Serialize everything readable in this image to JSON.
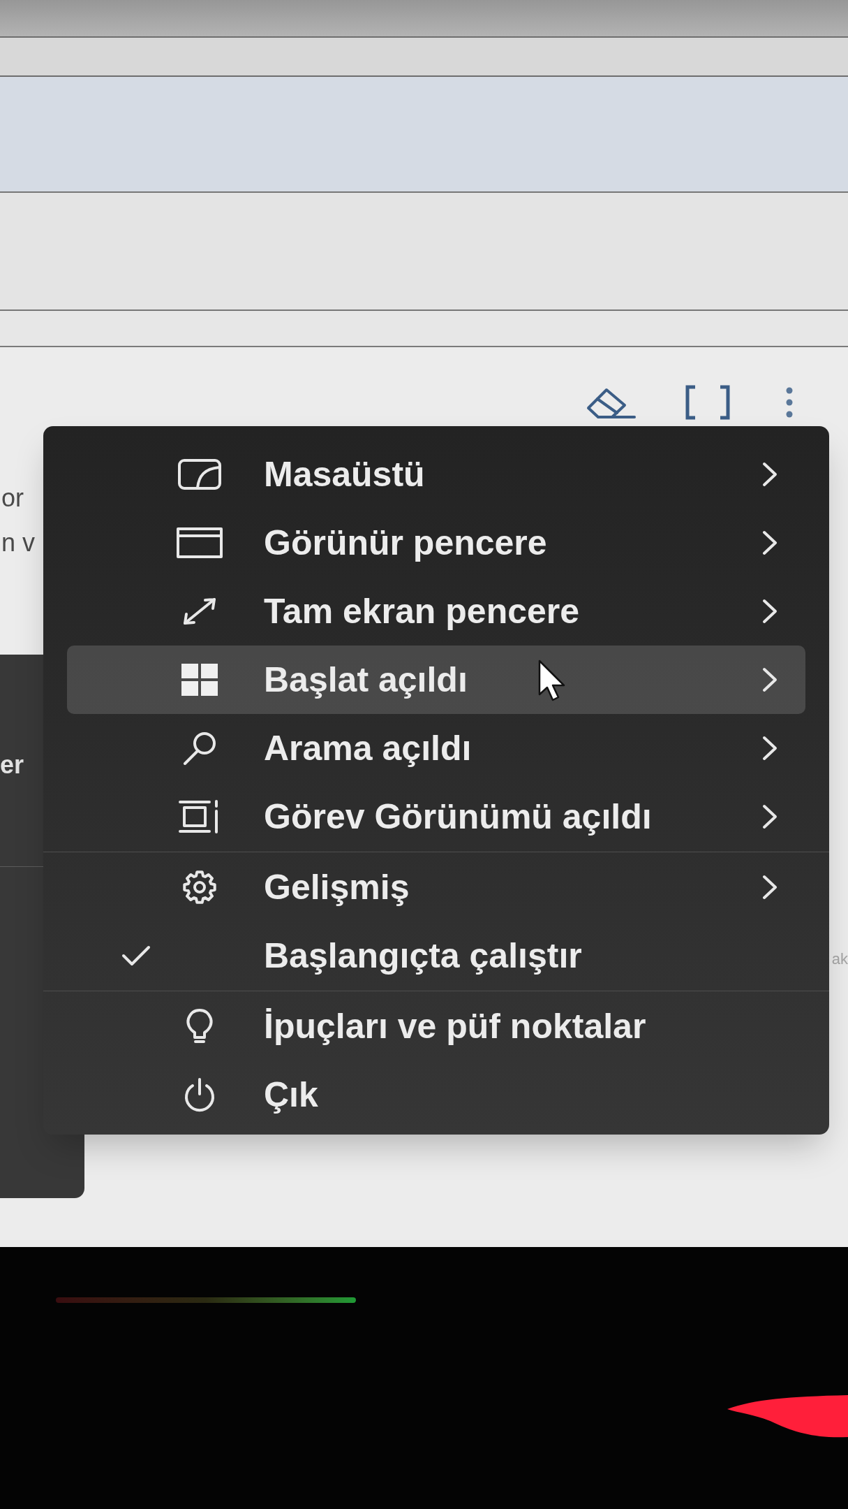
{
  "page": {
    "left_fragments": [
      {
        "text": "or"
      },
      {
        "text": "n v"
      }
    ],
    "right_fragment": "ak"
  },
  "side_panel": {
    "text": "er"
  },
  "context_menu": {
    "sections": [
      {
        "items": [
          {
            "label": "Masaüstü",
            "kind": "submenu",
            "selected": false,
            "checked": false
          },
          {
            "label": "Görünür pencere",
            "kind": "submenu",
            "selected": false,
            "checked": false
          },
          {
            "label": "Tam ekran pencere",
            "kind": "submenu",
            "selected": false,
            "checked": false
          },
          {
            "label": "Başlat açıldı",
            "kind": "submenu",
            "selected": true,
            "checked": false
          },
          {
            "label": "Arama açıldı",
            "kind": "submenu",
            "selected": false,
            "checked": false
          },
          {
            "label": "Görev Görünümü açıldı",
            "kind": "submenu",
            "selected": false,
            "checked": false
          }
        ]
      },
      {
        "items": [
          {
            "label": "Gelişmiş",
            "kind": "submenu",
            "selected": false,
            "checked": false
          },
          {
            "label": "Başlangıçta çalıştır",
            "kind": "toggle",
            "selected": false,
            "checked": true
          }
        ]
      },
      {
        "items": [
          {
            "label": "İpuçları ve püf noktalar",
            "kind": "action",
            "selected": false,
            "checked": false
          },
          {
            "label": "Çık",
            "kind": "action",
            "selected": false,
            "checked": false
          }
        ]
      }
    ]
  }
}
